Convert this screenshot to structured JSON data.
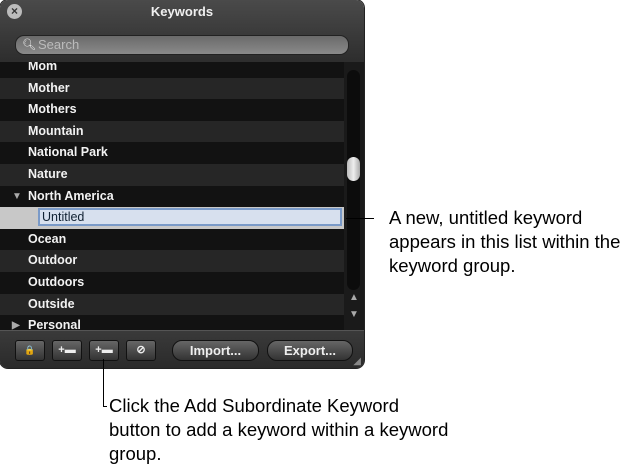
{
  "window": {
    "title": "Keywords",
    "close_icon": "close-icon"
  },
  "search": {
    "placeholder": "Search"
  },
  "keywords": [
    "Mom",
    "Mother",
    "Mothers",
    "Mountain",
    "National Park",
    "Nature",
    "North America",
    "Untitled",
    "Ocean",
    "Outdoor",
    "Outdoors",
    "Outside",
    "Personal"
  ],
  "toolbar": {
    "lock": "🔒",
    "add_keyword": "+▬",
    "add_subordinate": "+▬",
    "remove": "⊘",
    "import_label": "Import...",
    "export_label": "Export..."
  },
  "callouts": {
    "new_keyword": "A new, untitled keyword appears in this list within the keyword group.",
    "add_subordinate": "Click the Add Subordinate Keyword button to add a keyword within a keyword group."
  }
}
